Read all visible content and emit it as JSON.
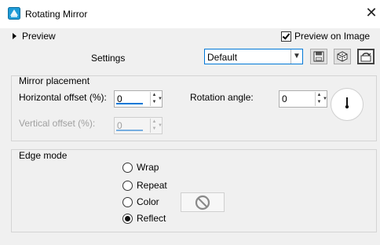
{
  "window": {
    "title": "Rotating Mirror",
    "close_glyph": "✕",
    "accent": "#0078d7",
    "icon": "app-icon"
  },
  "preview": {
    "label": "Preview",
    "preview_on_image_label": "Preview on Image",
    "preview_on_image_checked": true
  },
  "settings": {
    "label": "Settings",
    "preset_value": "Default",
    "buttons": [
      "save-preset-icon",
      "randomize-icon",
      "reset-icon"
    ]
  },
  "mirror_placement": {
    "title": "Mirror placement",
    "horizontal_label": "Horizontal offset (%):",
    "horizontal_value": "0",
    "vertical_label": "Vertical offset (%):",
    "vertical_value": "0",
    "rotation_label": "Rotation angle:",
    "rotation_value": "0"
  },
  "edge_mode": {
    "title": "Edge mode",
    "options": [
      {
        "label": "Wrap",
        "selected": false
      },
      {
        "label": "Repeat",
        "selected": false
      },
      {
        "label": "Color",
        "selected": false
      },
      {
        "label": "Reflect",
        "selected": true
      }
    ],
    "color_swatch_icon": "no-color-icon"
  }
}
